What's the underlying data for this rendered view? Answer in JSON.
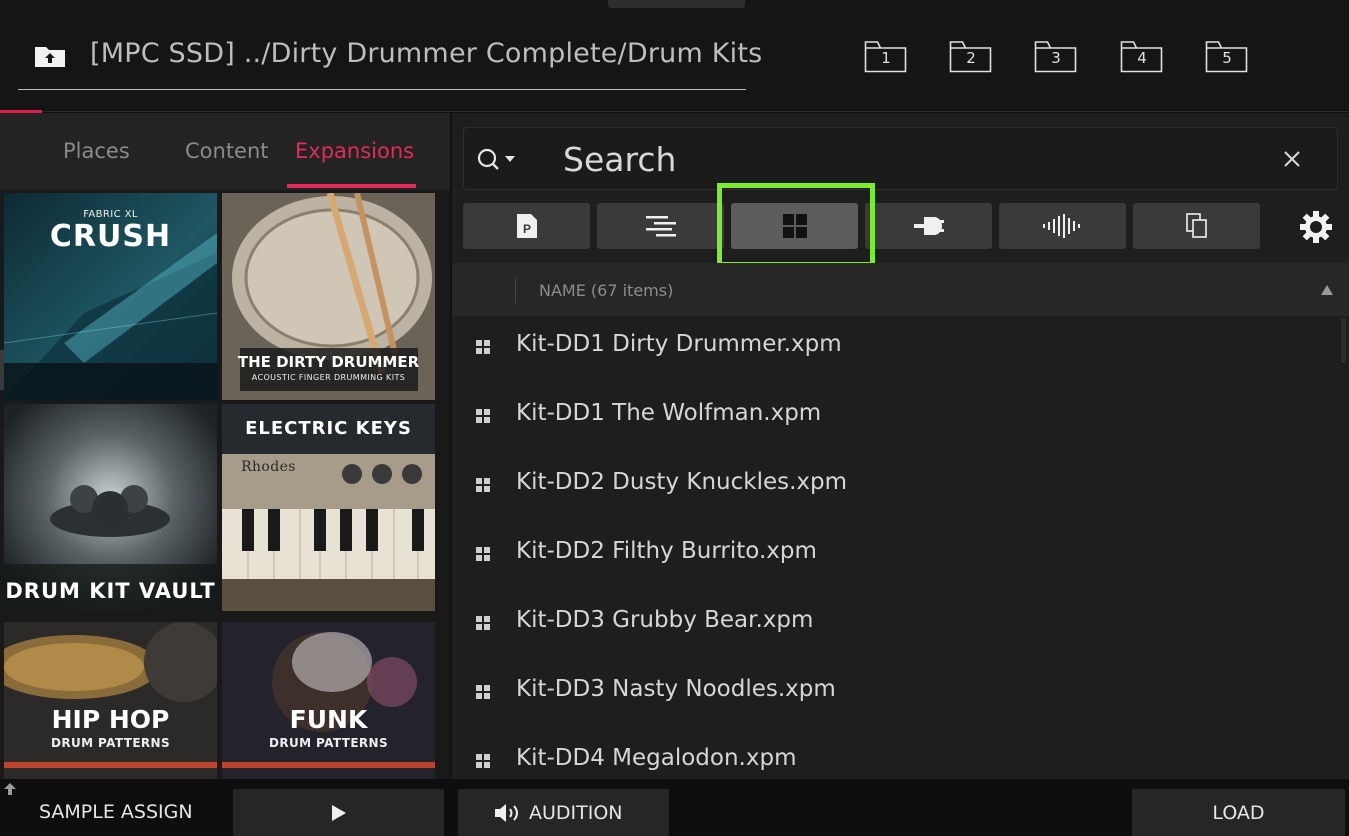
{
  "header": {
    "path": "[MPC SSD] ../Dirty Drummer Complete/Drum Kits",
    "favorites": [
      "1",
      "2",
      "3",
      "4",
      "5"
    ]
  },
  "left_panel": {
    "tabs": [
      {
        "label": "Places",
        "active": false
      },
      {
        "label": "Content",
        "active": false
      },
      {
        "label": "Expansions",
        "active": true
      }
    ],
    "expansions": [
      {
        "brand": "FABRIC XL",
        "title": "CRUSH"
      },
      {
        "title": "THE DIRTY DRUMMER",
        "subtitle": "ACOUSTIC FINGER DRUMMING KITS"
      },
      {
        "title": "DRUM KIT VAULT"
      },
      {
        "title": "ELECTRIC KEYS",
        "brand": "Rhodes"
      },
      {
        "title": "HIP HOP",
        "subtitle": "DRUM PATTERNS"
      },
      {
        "title": "FUNK",
        "subtitle": "DRUM PATTERNS"
      }
    ]
  },
  "search": {
    "placeholder": "Search"
  },
  "filters": [
    {
      "icon": "program-icon",
      "selected": false
    },
    {
      "icon": "sequence-icon",
      "selected": false
    },
    {
      "icon": "drum-kit-grid-icon",
      "selected": true
    },
    {
      "icon": "plugin-icon",
      "selected": false
    },
    {
      "icon": "waveform-icon",
      "selected": false
    },
    {
      "icon": "copy-icon",
      "selected": false
    }
  ],
  "list": {
    "header": "NAME (67 items)",
    "items": [
      "Kit-DD1 Dirty Drummer.xpm",
      "Kit-DD1 The Wolfman.xpm",
      "Kit-DD2 Dusty Knuckles.xpm",
      "Kit-DD2 Filthy Burrito.xpm",
      "Kit-DD3 Grubby Bear.xpm",
      "Kit-DD3 Nasty Noodles.xpm",
      "Kit-DD4 Megalodon.xpm"
    ]
  },
  "bottom": {
    "sample_assign": "SAMPLE ASSIGN",
    "audition": "AUDITION",
    "load": "LOAD"
  },
  "colors": {
    "accent": "#e22b5a",
    "highlight": "#7dea2c"
  }
}
